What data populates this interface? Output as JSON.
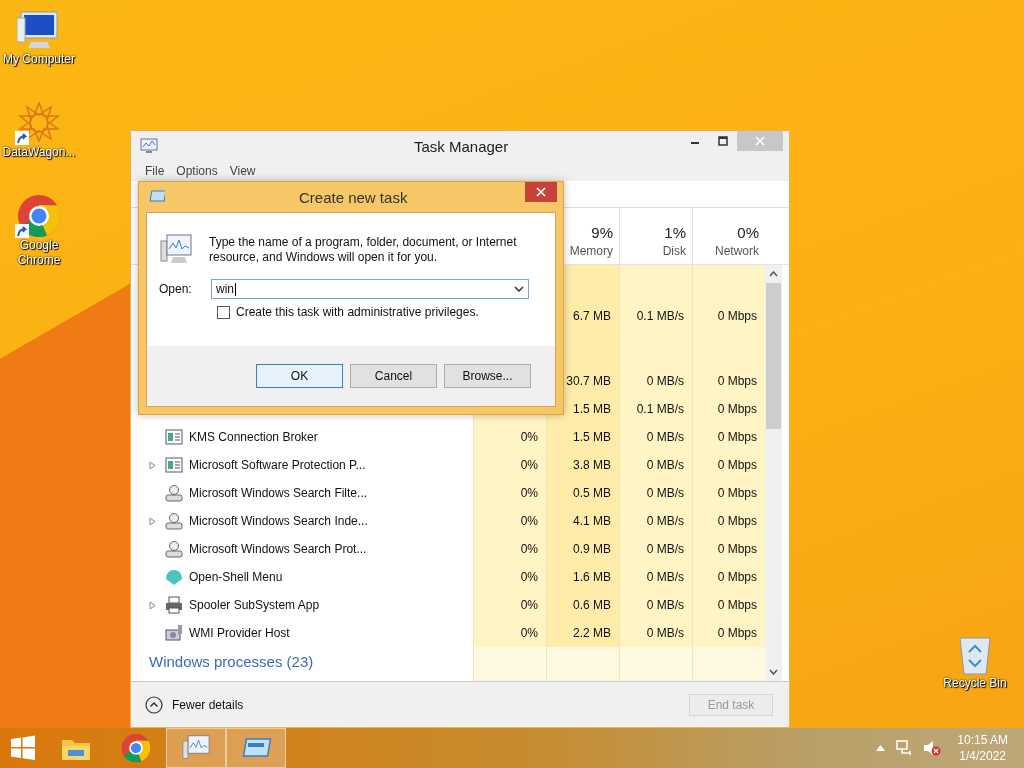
{
  "desktop_icons": [
    {
      "kind": "computer",
      "label": "My Computer",
      "shortcut": false
    },
    {
      "kind": "star",
      "label": "DataWagon...",
      "shortcut": true
    },
    {
      "kind": "chrome",
      "label": "Google Chrome",
      "shortcut": true
    }
  ],
  "recycle_bin": {
    "label": "Recycle Bin"
  },
  "task_manager": {
    "title": "Task Manager",
    "menu": [
      "File",
      "Options",
      "View"
    ],
    "columns": [
      {
        "percent": "9%",
        "label": "Memory"
      },
      {
        "percent": "1%",
        "label": "Disk"
      },
      {
        "percent": "0%",
        "label": "Network"
      }
    ],
    "rows": [
      {
        "kind": "blank"
      },
      {
        "kind": "covered",
        "memory": "6.7 MB",
        "disk": "0.1 MB/s",
        "network": "0 Mbps"
      },
      {
        "kind": "blank"
      },
      {
        "kind": "covered",
        "memory": "30.7 MB",
        "disk": "0 MB/s",
        "network": "0 Mbps"
      },
      {
        "kind": "covered",
        "memory": "1.5 MB",
        "disk": "0.1 MB/s",
        "network": "0 Mbps"
      },
      {
        "kind": "window",
        "expandable": false,
        "name": "KMS Connection Broker",
        "cpu": "0%",
        "memory": "1.5 MB",
        "disk": "0 MB/s",
        "network": "0 Mbps"
      },
      {
        "kind": "window",
        "expandable": true,
        "name": "Microsoft Software Protection P...",
        "cpu": "0%",
        "memory": "3.8 MB",
        "disk": "0 MB/s",
        "network": "0 Mbps"
      },
      {
        "kind": "user",
        "expandable": false,
        "name": "Microsoft Windows Search Filte...",
        "cpu": "0%",
        "memory": "0.5 MB",
        "disk": "0 MB/s",
        "network": "0 Mbps"
      },
      {
        "kind": "user",
        "expandable": true,
        "name": "Microsoft Windows Search Inde...",
        "cpu": "0%",
        "memory": "4.1 MB",
        "disk": "0 MB/s",
        "network": "0 Mbps"
      },
      {
        "kind": "user",
        "expandable": false,
        "name": "Microsoft Windows Search Prot...",
        "cpu": "0%",
        "memory": "0.9 MB",
        "disk": "0 MB/s",
        "network": "0 Mbps"
      },
      {
        "kind": "shell",
        "expandable": false,
        "name": "Open-Shell Menu",
        "cpu": "0%",
        "memory": "1.6 MB",
        "disk": "0 MB/s",
        "network": "0 Mbps"
      },
      {
        "kind": "printer",
        "expandable": true,
        "name": "Spooler SubSystem App",
        "cpu": "0%",
        "memory": "0.6 MB",
        "disk": "0 MB/s",
        "network": "0 Mbps"
      },
      {
        "kind": "gears",
        "expandable": false,
        "name": "WMI Provider Host",
        "cpu": "0%",
        "memory": "2.2 MB",
        "disk": "0 MB/s",
        "network": "0 Mbps"
      }
    ],
    "section_header": "Windows processes (23)",
    "fewer_details": "Fewer details",
    "end_task": {
      "label": "End task",
      "disabled": true
    }
  },
  "dialog": {
    "title": "Create new task",
    "message": "Type the name of a program, folder, document, or Internet resource, and Windows will open it for you.",
    "open_label": "Open:",
    "open_value": "win",
    "admin_checkbox": {
      "label": "Create this task with administrative privileges.",
      "checked": false
    },
    "buttons": [
      {
        "label": "OK",
        "selected": true
      },
      {
        "label": "Cancel",
        "selected": false
      },
      {
        "label": "Browse...",
        "selected": false
      }
    ]
  },
  "taskbar": {
    "items": [
      {
        "kind": "explorer",
        "selected": false
      },
      {
        "kind": "chrome",
        "selected": false
      },
      {
        "kind": "taskmgr",
        "selected": true
      },
      {
        "kind": "run",
        "selected": true
      }
    ],
    "time": "10:15 AM",
    "date": "1/4/2022"
  }
}
